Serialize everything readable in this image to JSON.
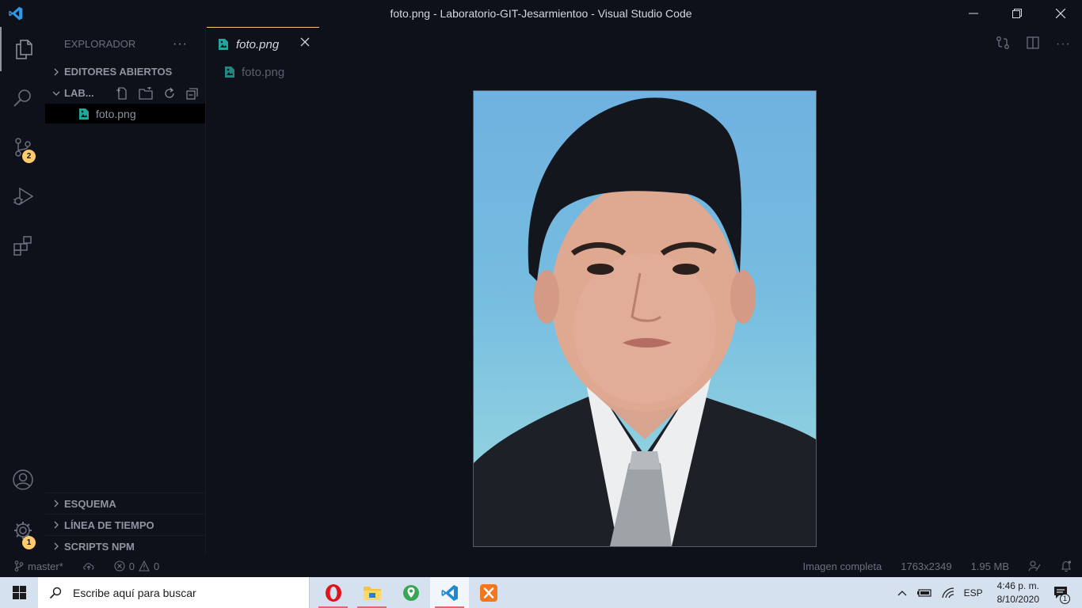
{
  "window": {
    "title": "foto.png - Laboratorio-GIT-Jesarmientoo - Visual Studio Code"
  },
  "activity_bar": {
    "items": [
      {
        "name": "explorer",
        "icon": "files-icon"
      },
      {
        "name": "search",
        "icon": "search-icon"
      },
      {
        "name": "source-control",
        "icon": "source-control-icon",
        "badge": "2"
      },
      {
        "name": "run-debug",
        "icon": "debug-icon"
      },
      {
        "name": "extensions",
        "icon": "extensions-icon"
      }
    ],
    "bottom": [
      {
        "name": "accounts",
        "icon": "account-icon"
      },
      {
        "name": "manage",
        "icon": "gear-icon",
        "badge": "1"
      }
    ]
  },
  "sidebar": {
    "title": "EXPLORADOR",
    "more": "···",
    "open_editors": "EDITORES ABIERTOS",
    "folder": "LAB...",
    "files": [
      "foto.png"
    ],
    "outline": "ESQUEMA",
    "timeline": "LÍNEA DE TIEMPO",
    "npm_scripts": "SCRIPTS NPM"
  },
  "editor": {
    "tabs": [
      {
        "label": "foto.png",
        "active": true
      }
    ],
    "breadcrumb": "foto.png"
  },
  "statusbar": {
    "branch": "master*",
    "errors": "0",
    "warnings": "0",
    "image_mode": "Imagen completa",
    "dimensions": "1763x2349",
    "size": "1.95 MB"
  },
  "taskbar": {
    "search_placeholder": "Escribe aquí para buscar",
    "apps": [
      "opera",
      "file-explorer",
      "maps",
      "vscode",
      "xampp"
    ],
    "language": "ESP",
    "time": "4:46 p. m.",
    "date": "8/10/2020",
    "notification_count": "1"
  },
  "colors": {
    "accent": "#ffcb6b",
    "background": "#0f111a",
    "file_icon": "#26a69a"
  }
}
